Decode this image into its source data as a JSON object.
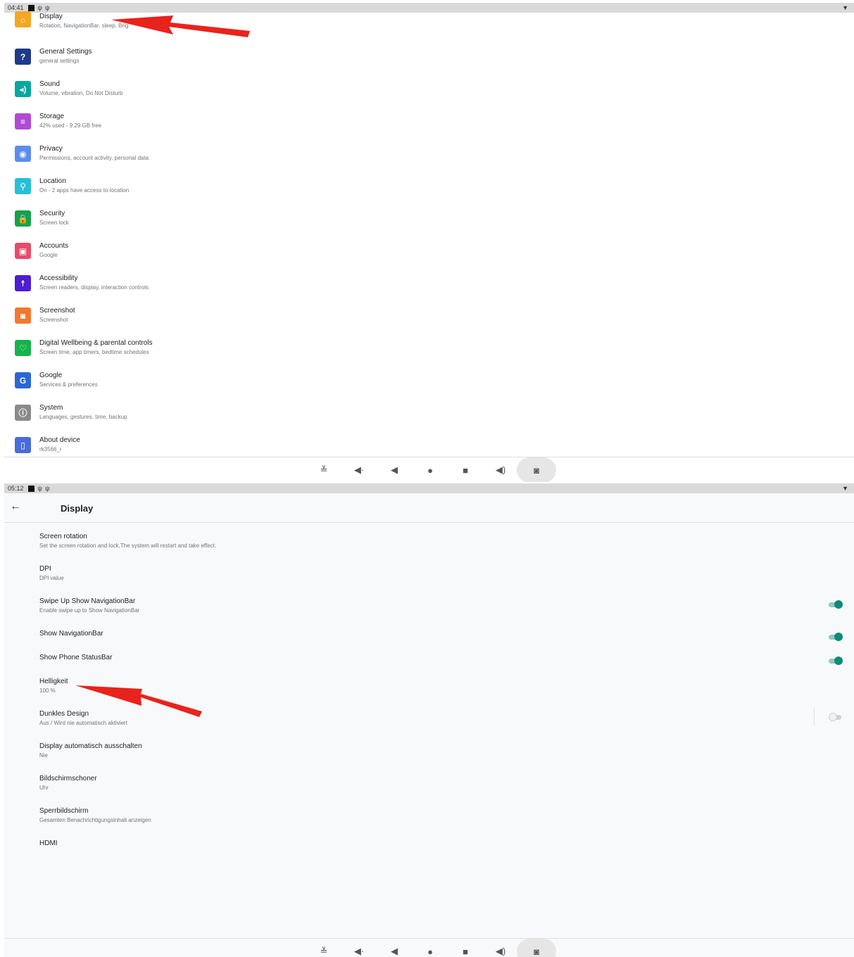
{
  "screen1": {
    "status": {
      "time": "04:41"
    },
    "settings": [
      {
        "title": "Display",
        "sub": "Rotation, NavigationBar, sleep, Brig",
        "icon": "display-icon",
        "glyph": "☼",
        "color": "#f5a623"
      },
      {
        "title": "General Settings",
        "sub": "general settings",
        "icon": "help-circle-icon",
        "glyph": "?",
        "color": "#1e3a8a"
      },
      {
        "title": "Sound",
        "sub": "Volume, vibration, Do Not Disturb",
        "icon": "volume-icon",
        "glyph": "◂)",
        "color": "#0aa6a0"
      },
      {
        "title": "Storage",
        "sub": "42% used - 9.29 GB free",
        "icon": "storage-icon",
        "glyph": "≡",
        "color": "#b04ad6"
      },
      {
        "title": "Privacy",
        "sub": "Permissions, account activity, personal data",
        "icon": "eye-lock-icon",
        "glyph": "◉",
        "color": "#5b8def"
      },
      {
        "title": "Location",
        "sub": "On - 2 apps have access to location",
        "icon": "location-pin-icon",
        "glyph": "⚲",
        "color": "#26c0d8"
      },
      {
        "title": "Security",
        "sub": "Screen lock",
        "icon": "lock-icon",
        "glyph": "🔒",
        "color": "#15a34a"
      },
      {
        "title": "Accounts",
        "sub": "Google",
        "icon": "account-box-icon",
        "glyph": "▣",
        "color": "#e94b6a"
      },
      {
        "title": "Accessibility",
        "sub": "Screen readers, display, interaction controls",
        "icon": "accessibility-icon",
        "glyph": "☨",
        "color": "#4c1ed4"
      },
      {
        "title": "Screenshot",
        "sub": "Screenshot",
        "icon": "camera-icon",
        "glyph": "◙",
        "color": "#f4772e"
      },
      {
        "title": "Digital Wellbeing & parental controls",
        "sub": "Screen time, app timers, bedtime schedules",
        "icon": "wellbeing-icon",
        "glyph": "♡",
        "color": "#17b34a"
      },
      {
        "title": "Google",
        "sub": "Services & preferences",
        "icon": "google-icon",
        "glyph": "G",
        "color": "#2a67d6"
      },
      {
        "title": "System",
        "sub": "Languages, gestures, time, backup",
        "icon": "info-icon",
        "glyph": "ⓘ",
        "color": "#8a8a8a"
      },
      {
        "title": "About device",
        "sub": "rk3566_r",
        "icon": "device-info-icon",
        "glyph": "▯",
        "color": "#4a6bdc"
      }
    ]
  },
  "screen2": {
    "status": {
      "time": "05:12"
    },
    "page_title": "Display",
    "prefs": [
      {
        "title": "Screen rotation",
        "sub": "Set the screen rotation and lock,The system will restart and take effect."
      },
      {
        "title": "DPI",
        "sub": "DPI value"
      },
      {
        "title": "Swipe Up Show NavigationBar",
        "sub": "Enable swipe up to Show NavigationBar"
      },
      {
        "title": "Show NavigationBar",
        "sub": ""
      },
      {
        "title": "Show Phone StatusBar",
        "sub": ""
      },
      {
        "title": "Helligkeit",
        "sub": "100 %"
      },
      {
        "title": "Dunkles Design",
        "sub": "Aus / Wird nie automatisch aktiviert"
      },
      {
        "title": "Display automatisch ausschalten",
        "sub": "Nie"
      },
      {
        "title": "Bildschirmschoner",
        "sub": "Uhr"
      },
      {
        "title": "Sperrbildschirm",
        "sub": "Gesamten Benachrichtigungsinhalt anzeigen"
      },
      {
        "title": "HDMI",
        "sub": ""
      }
    ],
    "toggles": {
      "swipe_up_show_navbar": true,
      "show_navbar": true,
      "show_phone_statusbar": true,
      "dark_theme": false
    }
  },
  "navbar_buttons": [
    {
      "name": "collapse-icon",
      "glyph": "≚"
    },
    {
      "name": "volume-down-icon",
      "glyph": "◀·"
    },
    {
      "name": "back-icon",
      "glyph": "◀"
    },
    {
      "name": "home-icon",
      "glyph": "●"
    },
    {
      "name": "recents-icon",
      "glyph": "■"
    },
    {
      "name": "volume-up-icon",
      "glyph": "◀)"
    },
    {
      "name": "screenshot-camera-icon",
      "glyph": "◙"
    }
  ],
  "colors": {
    "arrow": "#e8231b",
    "toggle_on": "#0e8a76"
  }
}
